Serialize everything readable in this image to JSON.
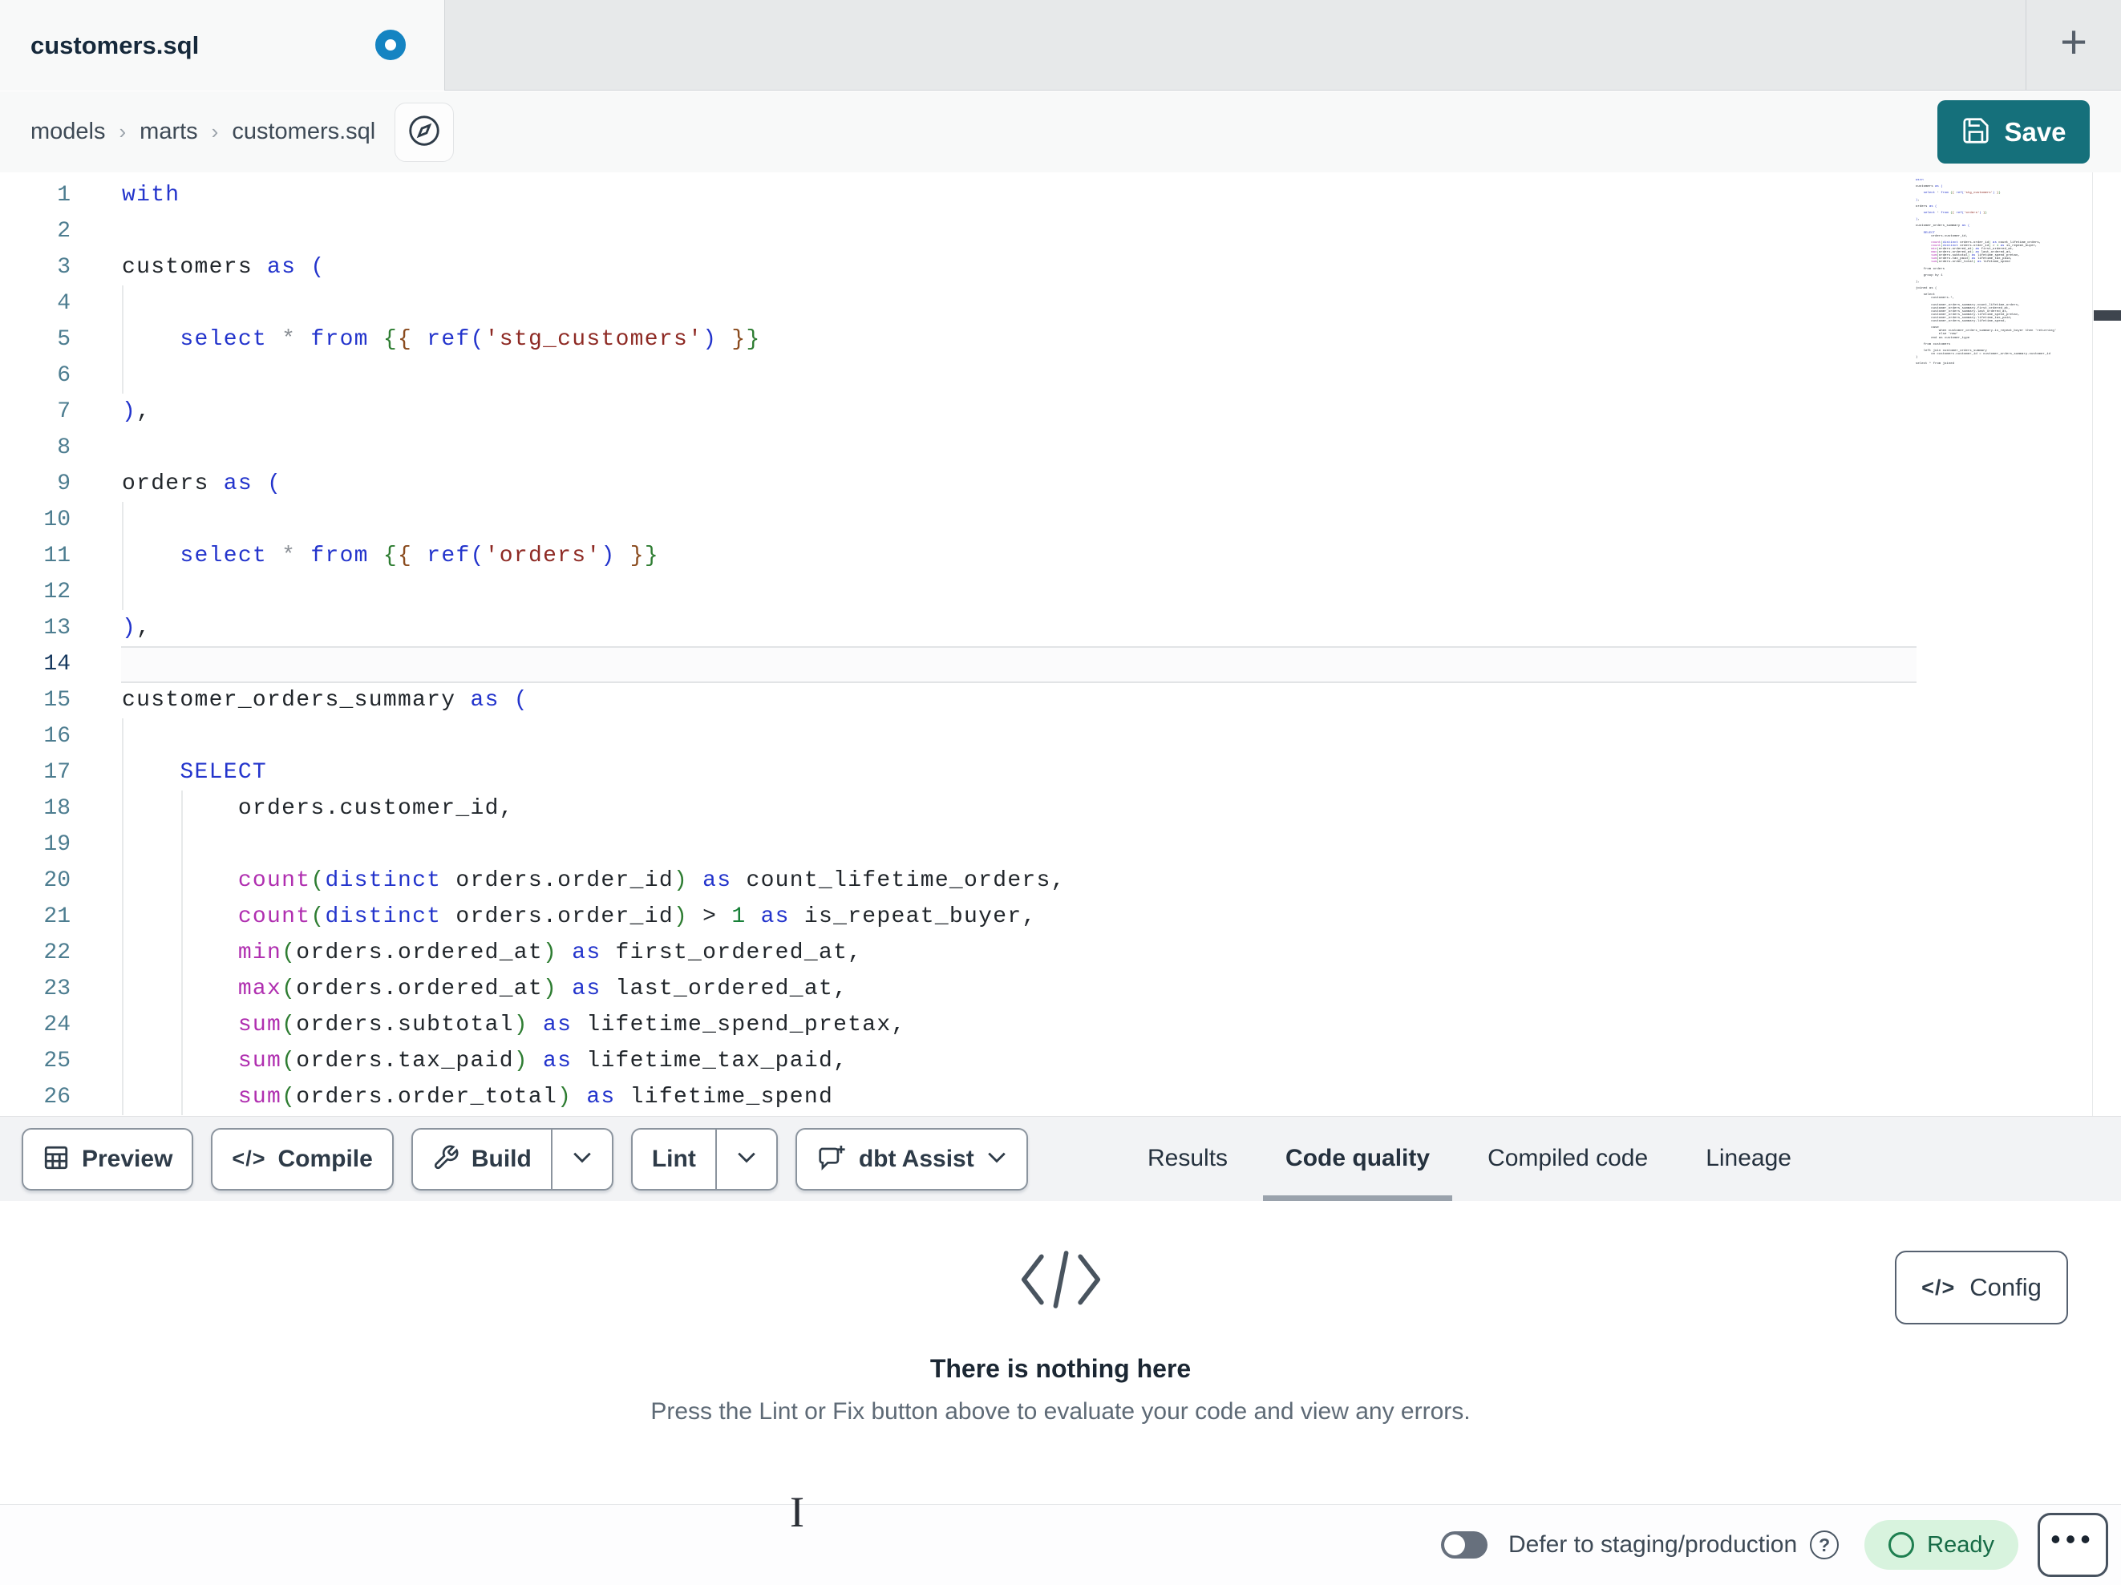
{
  "tabbar": {
    "tab_title": "customers.sql",
    "new_tab_label": "+"
  },
  "breadcrumb": {
    "items": [
      "models",
      "marts",
      "customers.sql"
    ],
    "separator": "›"
  },
  "save": {
    "label": "Save",
    "color": "#15707b"
  },
  "editor": {
    "active_line": 14,
    "colors": {
      "kw": "#2334cc",
      "fn": "#b02fb0",
      "str": "#8e2a24",
      "g": "#2e7d32",
      "m": "#8a4b1e",
      "num": "#188038",
      "op": "#8b9096",
      "id": "#21262b"
    },
    "lines": [
      [
        [
          "kw",
          "with"
        ]
      ],
      [],
      [
        [
          "id",
          "customers "
        ],
        [
          "kw",
          "as"
        ],
        [
          "id",
          " "
        ],
        [
          "kw",
          "("
        ]
      ],
      [],
      [
        [
          "id",
          "    "
        ],
        [
          "kw",
          "select"
        ],
        [
          "id",
          " "
        ],
        [
          "op",
          "*"
        ],
        [
          "id",
          " "
        ],
        [
          "kw",
          "from"
        ],
        [
          "id",
          " "
        ],
        [
          "g",
          "{"
        ],
        [
          "m",
          "{"
        ],
        [
          "id",
          " "
        ],
        [
          "kw",
          "ref"
        ],
        [
          "kw",
          "("
        ],
        [
          "str",
          "'stg_customers'"
        ],
        [
          "kw",
          ")"
        ],
        [
          "id",
          " "
        ],
        [
          "m",
          "}"
        ],
        [
          "g",
          "}"
        ]
      ],
      [],
      [
        [
          "kw",
          ")"
        ],
        [
          "id",
          ","
        ]
      ],
      [],
      [
        [
          "id",
          "orders "
        ],
        [
          "kw",
          "as"
        ],
        [
          "id",
          " "
        ],
        [
          "kw",
          "("
        ]
      ],
      [],
      [
        [
          "id",
          "    "
        ],
        [
          "kw",
          "select"
        ],
        [
          "id",
          " "
        ],
        [
          "op",
          "*"
        ],
        [
          "id",
          " "
        ],
        [
          "kw",
          "from"
        ],
        [
          "id",
          " "
        ],
        [
          "g",
          "{"
        ],
        [
          "m",
          "{"
        ],
        [
          "id",
          " "
        ],
        [
          "kw",
          "ref"
        ],
        [
          "kw",
          "("
        ],
        [
          "str",
          "'orders'"
        ],
        [
          "kw",
          ")"
        ],
        [
          "id",
          " "
        ],
        [
          "m",
          "}"
        ],
        [
          "g",
          "}"
        ]
      ],
      [],
      [
        [
          "kw",
          ")"
        ],
        [
          "id",
          ","
        ]
      ],
      [],
      [
        [
          "id",
          "customer_orders_summary "
        ],
        [
          "kw",
          "as"
        ],
        [
          "id",
          " "
        ],
        [
          "kw",
          "("
        ]
      ],
      [],
      [
        [
          "id",
          "    "
        ],
        [
          "kw",
          "SELECT"
        ]
      ],
      [
        [
          "id",
          "        orders.customer_id,"
        ]
      ],
      [],
      [
        [
          "id",
          "        "
        ],
        [
          "fn",
          "count"
        ],
        [
          "g",
          "("
        ],
        [
          "kw",
          "distinct"
        ],
        [
          "id",
          " orders.order_id"
        ],
        [
          "g",
          ")"
        ],
        [
          "id",
          " "
        ],
        [
          "kw",
          "as"
        ],
        [
          "id",
          " count_lifetime_orders,"
        ]
      ],
      [
        [
          "id",
          "        "
        ],
        [
          "fn",
          "count"
        ],
        [
          "g",
          "("
        ],
        [
          "kw",
          "distinct"
        ],
        [
          "id",
          " orders.order_id"
        ],
        [
          "g",
          ")"
        ],
        [
          "id",
          " > "
        ],
        [
          "num",
          "1"
        ],
        [
          "id",
          " "
        ],
        [
          "kw",
          "as"
        ],
        [
          "id",
          " is_repeat_buyer,"
        ]
      ],
      [
        [
          "id",
          "        "
        ],
        [
          "fn",
          "min"
        ],
        [
          "g",
          "("
        ],
        [
          "id",
          "orders.ordered_at"
        ],
        [
          "g",
          ")"
        ],
        [
          "id",
          " "
        ],
        [
          "kw",
          "as"
        ],
        [
          "id",
          " first_ordered_at,"
        ]
      ],
      [
        [
          "id",
          "        "
        ],
        [
          "fn",
          "max"
        ],
        [
          "g",
          "("
        ],
        [
          "id",
          "orders.ordered_at"
        ],
        [
          "g",
          ")"
        ],
        [
          "id",
          " "
        ],
        [
          "kw",
          "as"
        ],
        [
          "id",
          " last_ordered_at,"
        ]
      ],
      [
        [
          "id",
          "        "
        ],
        [
          "fn",
          "sum"
        ],
        [
          "g",
          "("
        ],
        [
          "id",
          "orders.subtotal"
        ],
        [
          "g",
          ")"
        ],
        [
          "id",
          " "
        ],
        [
          "kw",
          "as"
        ],
        [
          "id",
          " lifetime_spend_pretax,"
        ]
      ],
      [
        [
          "id",
          "        "
        ],
        [
          "fn",
          "sum"
        ],
        [
          "g",
          "("
        ],
        [
          "id",
          "orders.tax_paid"
        ],
        [
          "g",
          ")"
        ],
        [
          "id",
          " "
        ],
        [
          "kw",
          "as"
        ],
        [
          "id",
          " lifetime_tax_paid,"
        ]
      ],
      [
        [
          "id",
          "        "
        ],
        [
          "fn",
          "sum"
        ],
        [
          "g",
          "("
        ],
        [
          "id",
          "orders.order_total"
        ],
        [
          "g",
          ")"
        ],
        [
          "id",
          " "
        ],
        [
          "kw",
          "as"
        ],
        [
          "id",
          " lifetime_spend"
        ]
      ]
    ],
    "minimap_extra": [
      "",
      "    from orders",
      "",
      "    group by 1",
      "",
      "),",
      "",
      "joined as (",
      "",
      "    select",
      "        customers.*,",
      "",
      "        customer_orders_summary.count_lifetime_orders,",
      "        customer_orders_summary.first_ordered_at,",
      "        customer_orders_summary.last_ordered_at,",
      "        customer_orders_summary.lifetime_spend_pretax,",
      "        customer_orders_summary.lifetime_tax_paid,",
      "        customer_orders_summary.lifetime_spend,",
      "",
      "        case",
      "            when customer_orders_summary.is_repeat_buyer then 'returning'",
      "            else 'new'",
      "        end as customer_type",
      "",
      "    from customers",
      "",
      "    left join customer_orders_summary",
      "        on customers.customer_id = customer_orders_summary.customer_id",
      ")",
      "",
      "select * from joined"
    ]
  },
  "toolbar": {
    "preview_label": "Preview",
    "compile_label": "Compile",
    "build_label": "Build",
    "lint_label": "Lint",
    "assist_label": "dbt Assist",
    "compile_glyph": "</>"
  },
  "panel_tabs": {
    "items": [
      "Results",
      "Code quality",
      "Compiled code",
      "Lineage"
    ],
    "active": "Code quality"
  },
  "empty_state": {
    "title": "There is nothing here",
    "subtitle": "Press the Lint or Fix button above to evaluate your code and view any errors."
  },
  "config_button": {
    "label": "Config",
    "glyph": "</>"
  },
  "statusbar": {
    "defer_label": "Defer to staging/production",
    "help_glyph": "?",
    "ready_label": "Ready",
    "ready_bg": "#d8f3de",
    "ready_text": "#166b46",
    "dots_glyph": "•••",
    "toggle_on": false
  }
}
